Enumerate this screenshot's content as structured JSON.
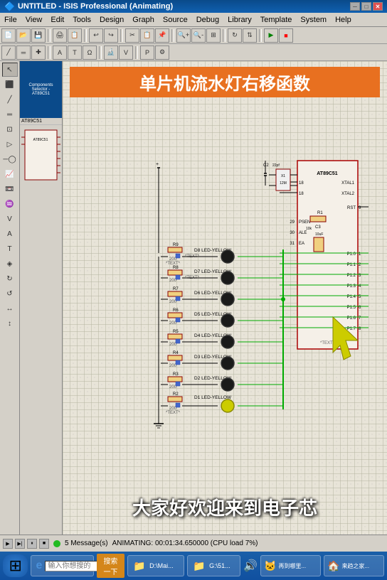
{
  "titlebar": {
    "title": "UNTITLED - ISIS Professional (Animating)",
    "minimize": "─",
    "maximize": "□",
    "close": "✕"
  },
  "menu": {
    "items": [
      "File",
      "View",
      "Edit",
      "Tools",
      "Design",
      "Graph",
      "Source",
      "Debug",
      "Library",
      "Template",
      "System",
      "Help"
    ]
  },
  "circuit": {
    "title": "单片机流水灯右移函数",
    "subtitle": "大家好欢迎来到电子芯",
    "components": {
      "leds": [
        {
          "id": "D8",
          "type": "LED-YELLOW",
          "resistor": "R9",
          "ohms": "200"
        },
        {
          "id": "D7",
          "type": "LED-YELLOW",
          "resistor": "R8",
          "ohms": "200"
        },
        {
          "id": "D6",
          "type": "LED-YELLOW",
          "resistor": "R7",
          "ohms": "200"
        },
        {
          "id": "D5",
          "type": "LED-YELLOW",
          "resistor": "R6",
          "ohms": "200"
        },
        {
          "id": "D4",
          "type": "LED-YELLOW",
          "resistor": "R5",
          "ohms": "200"
        },
        {
          "id": "D3",
          "type": "LED-YELLOW",
          "resistor": "R4",
          "ohms": "200"
        },
        {
          "id": "D2",
          "type": "LED-YELLOW",
          "resistor": "R3",
          "ohms": "200"
        },
        {
          "id": "D1",
          "type": "LED-YELLOW",
          "resistor": "R2",
          "ohms": "200"
        }
      ],
      "mcu": {
        "name": "AT89C51",
        "pins": [
          "XTAL1",
          "XTAL2",
          "RST",
          "PSEN",
          "ALE",
          "EA",
          "P1.0",
          "P1.1",
          "P1.2",
          "P1.3",
          "P1.4",
          "P1.5",
          "P1.6",
          "P1.7"
        ]
      },
      "crystal": {
        "name": "X1",
        "value": "12M"
      },
      "capacitors": [
        {
          "name": "C2",
          "value": "22pf"
        },
        {
          "name": "C3",
          "value": "10uF"
        }
      ],
      "resistor": {
        "name": "R1",
        "value": "10k"
      }
    }
  },
  "status": {
    "messages": "5 Message(s)",
    "animating": "ANIMATING: 00:01:34.650000 (CPU load 7%)"
  },
  "taskbar": {
    "start_icon": "⊞",
    "ie_icon": "e",
    "search_placeholder": "输入你想搜的",
    "search_btn": "搜索一下",
    "items": [
      {
        "icon": "📁",
        "label": "D:\\Mai..."
      },
      {
        "icon": "📁",
        "label": "G:\\51..."
      }
    ],
    "tray_items": [
      {
        "icon": "🐱",
        "label": "再到哪里..."
      },
      {
        "icon": "🏠",
        "label": "来趋之家..."
      }
    ]
  },
  "selector": {
    "label": "Components Selector - AT89C51"
  }
}
